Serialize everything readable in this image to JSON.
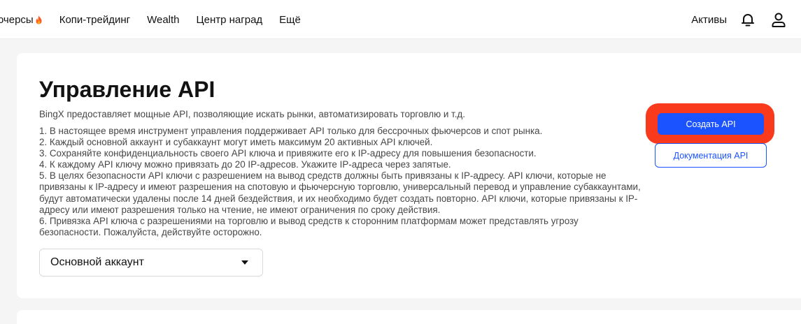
{
  "nav": {
    "items": [
      {
        "label": "ючерсы",
        "icon": "fire-icon"
      },
      {
        "label": "Копи-трейдинг"
      },
      {
        "label": "Wealth"
      },
      {
        "label": "Центр наград"
      },
      {
        "label": "Ещё"
      }
    ],
    "assets_label": "Активы",
    "icons": [
      "bell-icon",
      "user-icon"
    ]
  },
  "main": {
    "title": "Управление API",
    "intro": "BingX предоставляет мощные API, позволяющие искать рынки, автоматизировать торговлю и т.д.",
    "rules": [
      "1. В настоящее время инструмент управления поддерживает API только для бессрочных фьючерсов и спот рынка.",
      "2. Каждый основной аккаунт и субаккаунт могут иметь максимум 20 активных API ключей.",
      "3. Сохраняйте конфиденциальность своего API ключа и привяжите его к IP-адресу для повышения безопасности.",
      "4. К каждому API ключу можно привязать до 20 IP-адресов. Укажите IP-адреса через запятые.",
      "5. В целях безопасности API ключи с разрешением на вывод средств должны быть привязаны к IP-адресу. API ключи, которые не привязаны к IP-адресу и имеют разрешения на спотовую и фьючерсную торговлю, универсальный перевод и управление субаккаунтами, будут автоматически удалены после 14 дней бездействия, и их необходимо будет создать повторно. API ключи, которые привязаны к IP-адресу или имеют разрешения только на чтение, не имеют ограничения по сроку действия.",
      "6. Привязка API ключа с разрешениями на торговлю и вывод средств к сторонним платформам может представлять угрозу безопасности. Пожалуйста, действуйте осторожно."
    ],
    "account_select": {
      "value": "Основной аккаунт",
      "icon": "caret-down-icon"
    },
    "create_button": "Создать API",
    "docs_button": "Документация API"
  },
  "colors": {
    "accent": "#1a53ff",
    "highlight": "#f93a1d",
    "fire": "#ff5a1f"
  }
}
